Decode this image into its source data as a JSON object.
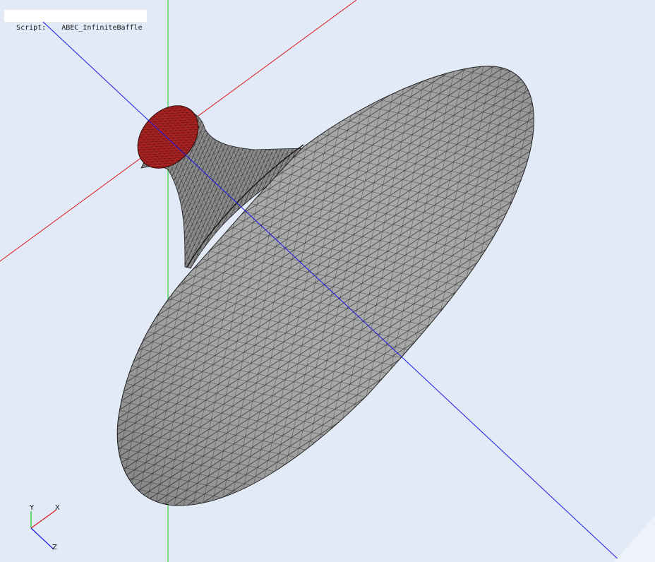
{
  "script": {
    "label": "Script:",
    "value": "ABEC_InfiniteBaffle"
  },
  "axes_triad": {
    "y": "Y",
    "x": "X",
    "z": "Z"
  },
  "colors": {
    "background": "#e1eaf6",
    "x_axis": "#e01818",
    "y_axis": "#18c818",
    "z_axis": "#1818e8",
    "mesh_fill": "#a8a8a8",
    "mesh_edge": "#1e1e1e",
    "throat_fill": "#b02424"
  }
}
